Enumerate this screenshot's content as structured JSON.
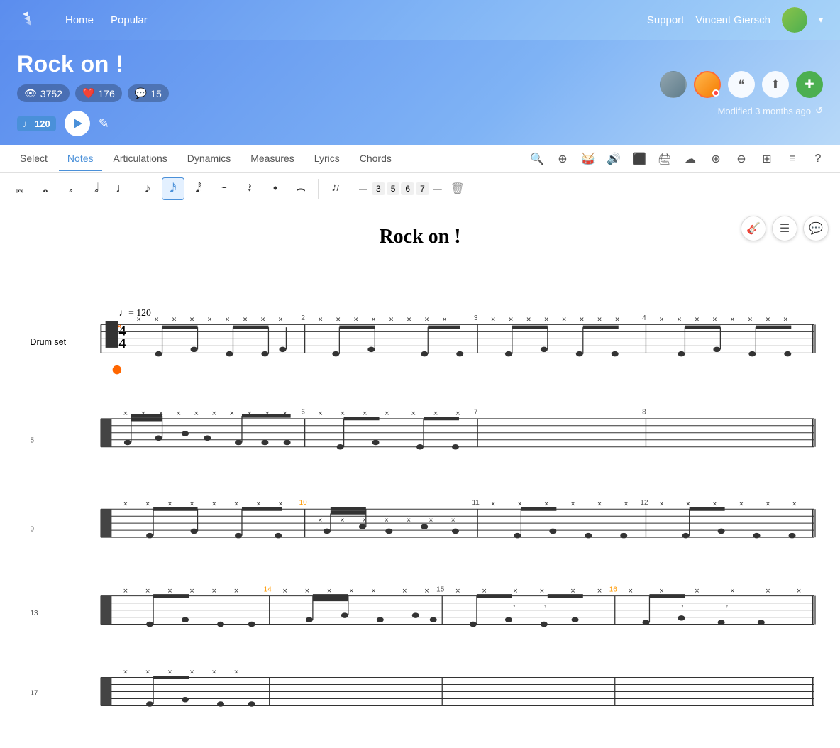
{
  "nav": {
    "home_label": "Home",
    "popular_label": "Popular",
    "support_label": "Support",
    "user_label": "Vincent Giersch"
  },
  "song": {
    "title": "Rock on !",
    "stats": {
      "views": "3752",
      "likes": "176",
      "comments": "15"
    },
    "bpm": "120",
    "modified": "Modified 3 months ago"
  },
  "tabs": {
    "items": [
      "Select",
      "Notes",
      "Articulations",
      "Dynamics",
      "Measures",
      "Lyrics",
      "Chords"
    ],
    "active": 1
  },
  "sheet": {
    "title": "Rock on !",
    "instrument": "Drum set",
    "tempo": "= 120"
  },
  "notes": {
    "duration_labels": [
      "𝅜",
      "𝅝",
      "𝅗",
      "𝅗𝅥",
      "♩",
      "♪",
      "𝅘𝅥𝅯",
      "𝅘𝅥𝅰",
      "𝄽",
      "𝄾"
    ],
    "tuplets": [
      "3",
      "5",
      "6",
      "7"
    ]
  }
}
